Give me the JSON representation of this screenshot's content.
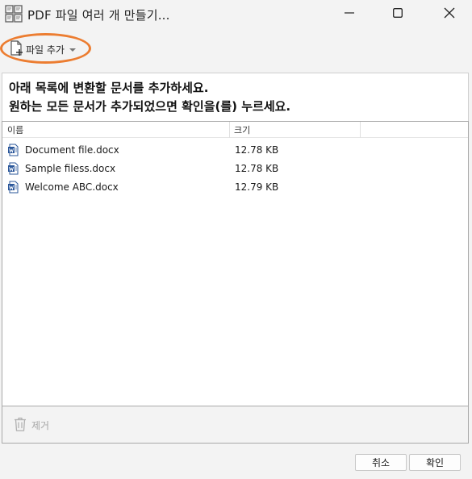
{
  "window": {
    "title": "PDF 파일 여러 개 만들기...",
    "icons": {
      "app": "pdf-merge-app-icon",
      "minimize": "minimize-icon",
      "maximize": "maximize-icon",
      "close": "close-icon"
    }
  },
  "toolbar": {
    "add_file_label": "파일 추가",
    "add_file_icon": "add-file-icon",
    "caret_icon": "chevron-down-icon",
    "highlight_color": "#ec7d31"
  },
  "instruction": {
    "line1": "아래 목록에 변환할 문서를 추가하세요.",
    "line2": "원하는 모든 문서가 추가되었으면 확인을(를) 누르세요."
  },
  "file_list": {
    "columns": [
      "이름",
      "크기"
    ],
    "rows": [
      {
        "name": "Document file.docx",
        "size": "12.78 KB",
        "icon": "word-doc-icon"
      },
      {
        "name": "Sample filess.docx",
        "size": "12.78 KB",
        "icon": "word-doc-icon"
      },
      {
        "name": "Welcome ABC.docx",
        "size": "12.79 KB",
        "icon": "word-doc-icon"
      }
    ]
  },
  "remove": {
    "label": "제거",
    "icon": "trash-icon"
  },
  "footer": {
    "cancel_label": "취소",
    "ok_label": "확인"
  }
}
